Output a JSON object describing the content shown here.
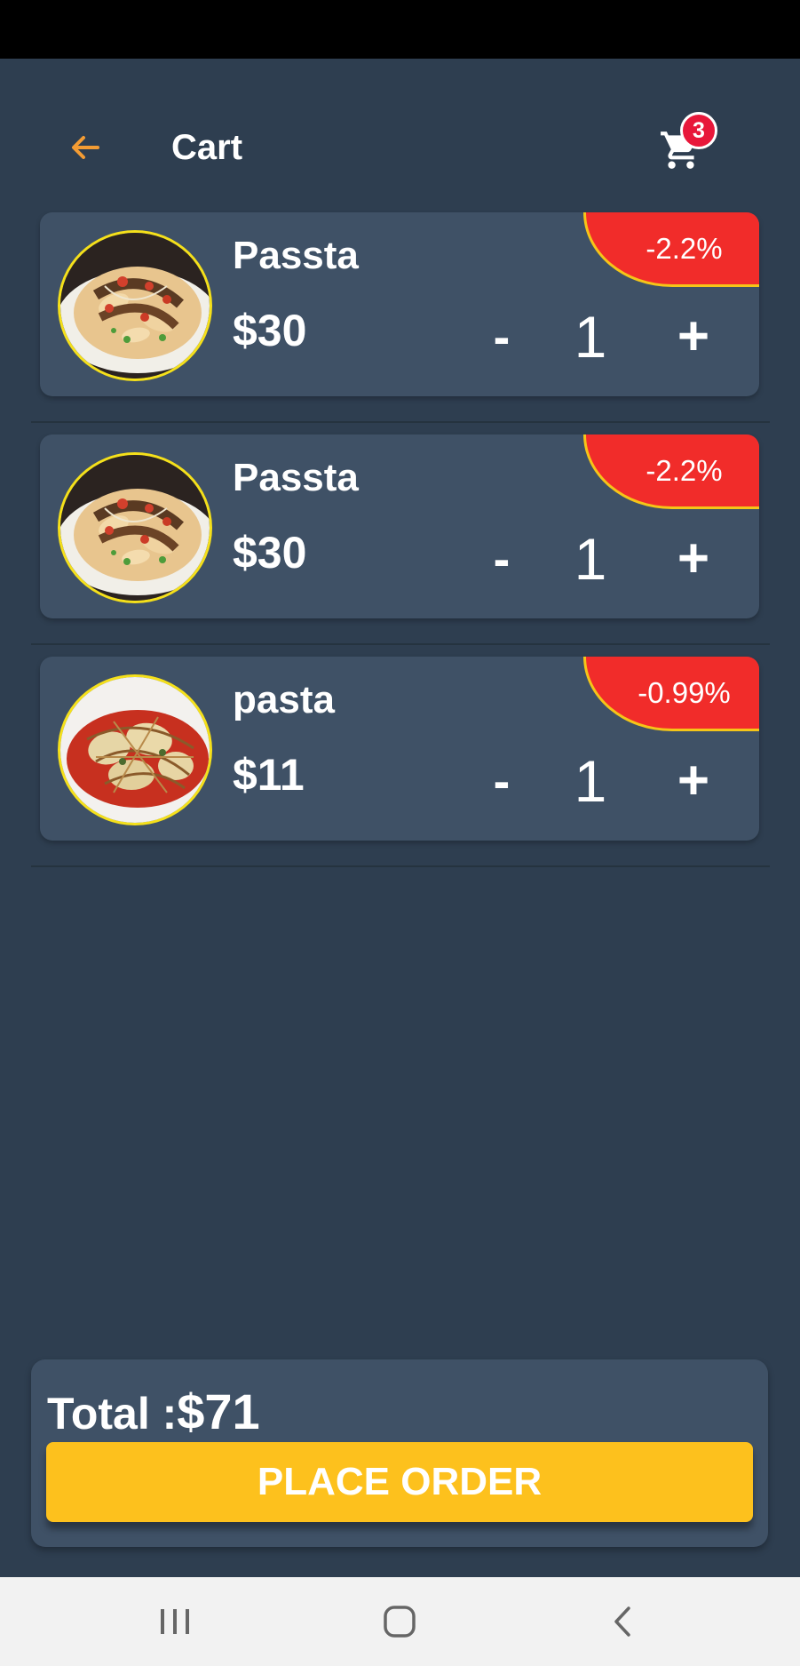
{
  "header": {
    "title": "Cart",
    "back_icon": "arrow-left-icon",
    "cart_icon": "cart-icon",
    "cart_count": "3"
  },
  "colors": {
    "background": "#2e3e50",
    "card": "#3f5166",
    "accent": "#fdc11d",
    "back_arrow": "#f39c34",
    "discount_bg": "#f12c2a",
    "discount_border": "#f5c518",
    "badge": "#e8173a"
  },
  "items": [
    {
      "name": "Passta",
      "price": "$30",
      "quantity": "1",
      "discount": "-2.2%",
      "minus": "-",
      "plus": "+",
      "image": "pasta-dish-image"
    },
    {
      "name": "Passta",
      "price": "$30",
      "quantity": "1",
      "discount": "-2.2%",
      "minus": "-",
      "plus": "+",
      "image": "pasta-dish-image"
    },
    {
      "name": "pasta",
      "price": "$11",
      "quantity": "1",
      "discount": "-0.99%",
      "minus": "-",
      "plus": "+",
      "image": "ravioli-dish-image"
    }
  ],
  "footer": {
    "total_label": "Total :",
    "total_value": "$71",
    "place_order_label": "PLACE ORDER"
  },
  "system_nav": {
    "recents_icon": "recents-icon",
    "home_icon": "home-icon",
    "back_icon": "back-chevron-icon"
  }
}
